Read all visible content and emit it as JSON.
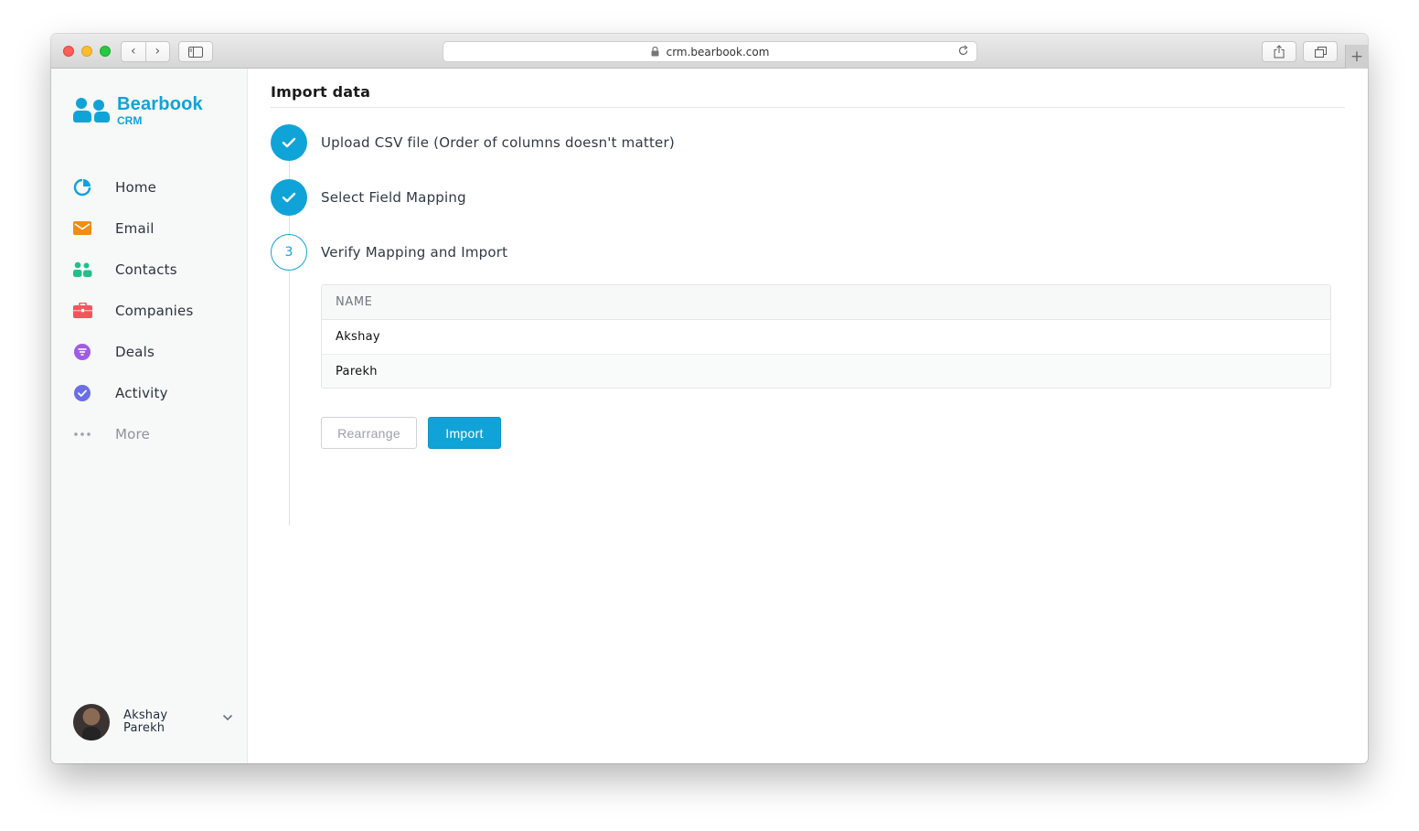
{
  "browser": {
    "url": "crm.bearbook.com",
    "back_glyph": "‹",
    "forward_glyph": "›",
    "new_tab_glyph": "+"
  },
  "brand": {
    "name": "Bearbook",
    "sub": "CRM",
    "color": "#10a3d8"
  },
  "nav": {
    "items": [
      {
        "label": "Home",
        "icon": "pie-chart-icon",
        "color": "#10a3d8"
      },
      {
        "label": "Email",
        "icon": "envelope-icon",
        "color": "#f28c12"
      },
      {
        "label": "Contacts",
        "icon": "people-icon",
        "color": "#20c08a"
      },
      {
        "label": "Companies",
        "icon": "briefcase-icon",
        "color": "#f2555a"
      },
      {
        "label": "Deals",
        "icon": "filter-icon",
        "color": "#a05ce6"
      },
      {
        "label": "Activity",
        "icon": "check-circle-icon",
        "color": "#6a6fe8"
      },
      {
        "label": "More",
        "icon": "more-dots-icon",
        "color": "#9aa1a8"
      }
    ]
  },
  "user": {
    "first_name": "Akshay",
    "last_name": "Parekh"
  },
  "main": {
    "title": "Import data",
    "steps": [
      {
        "label": "Upload CSV file (Order of columns doesn't matter)",
        "state": "done"
      },
      {
        "label": "Select Field Mapping",
        "state": "done"
      },
      {
        "label": "Verify Mapping and Import",
        "state": "current",
        "number": "3"
      }
    ],
    "table": {
      "header": "NAME",
      "rows": [
        "Akshay",
        "Parekh"
      ]
    },
    "buttons": {
      "secondary": "Rearrange",
      "primary": "Import"
    }
  }
}
